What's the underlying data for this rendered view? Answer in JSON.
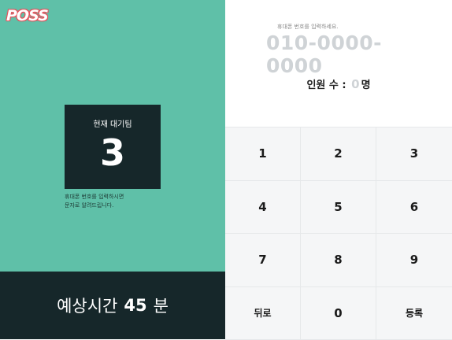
{
  "app": {
    "logo_text": "POSS"
  },
  "queue": {
    "label": "현재 대기팀",
    "count": "3",
    "notice_line1": "휴대폰 번호를 입력하시면",
    "notice_line2": "문자로 알려드립니다."
  },
  "eta": {
    "prefix": "예상시간",
    "value": "45",
    "unit": "분"
  },
  "entry": {
    "phone_hint": "휴대폰 번호를 입력하세요.",
    "phone_placeholder": "010-0000-0000",
    "people_label": "인원 수 :",
    "people_count": "0",
    "people_unit": "명"
  },
  "keypad": {
    "k1": "1",
    "k2": "2",
    "k3": "3",
    "k4": "4",
    "k5": "5",
    "k6": "6",
    "k7": "7",
    "k8": "8",
    "k9": "9",
    "back": "뒤로",
    "k0": "0",
    "register": "등록"
  },
  "colors": {
    "teal": "#5fc0a8",
    "dark": "#16272a",
    "logo_accent": "#e8505b"
  }
}
